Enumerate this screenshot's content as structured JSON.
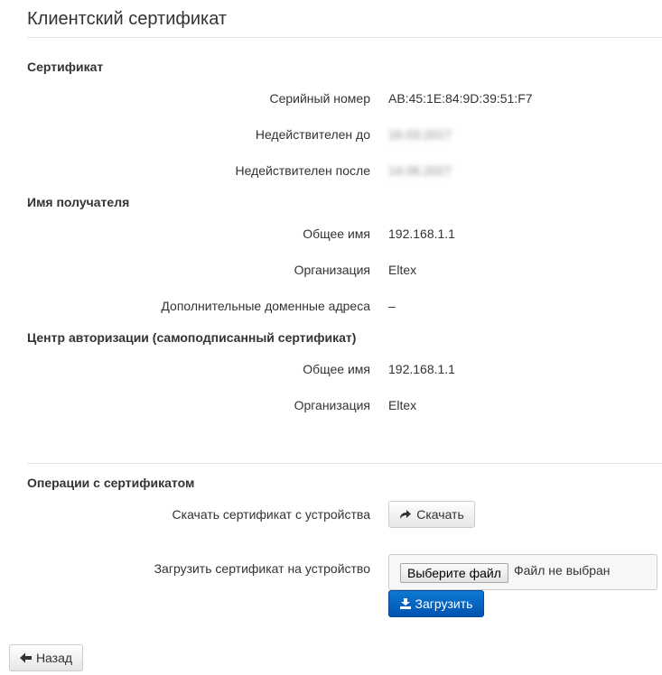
{
  "page": {
    "title": "Клиентский сертификат"
  },
  "certificate": {
    "section_title": "Сертификат",
    "rows": [
      {
        "label": "Серийный номер",
        "value": "AB:45:1E:84:9D:39:51:F7"
      },
      {
        "label": "Недействителен до",
        "value": "16.03.2017"
      },
      {
        "label": "Недействителен после",
        "value": "14.06.2027"
      }
    ]
  },
  "subject": {
    "section_title": "Имя получателя",
    "rows": [
      {
        "label": "Общее имя",
        "value": "192.168.1.1"
      },
      {
        "label": "Организация",
        "value": "Eltex"
      },
      {
        "label": "Дополнительные доменные адреса",
        "value": "–"
      }
    ]
  },
  "issuer": {
    "section_title": "Центр авторизации (самоподписанный сертификат)",
    "rows": [
      {
        "label": "Общее имя",
        "value": "192.168.1.1"
      },
      {
        "label": "Организация",
        "value": "Eltex"
      }
    ]
  },
  "operations": {
    "section_title": "Операции с сертификатом",
    "download_label": "Скачать сертификат с устройства",
    "download_button": "Скачать",
    "download_icon": "share-arrow-icon",
    "upload_label": "Загрузить сертификат на устройство",
    "choose_file_button": "Выберите файл",
    "file_status": "Файл не выбран",
    "upload_button": "Загрузить",
    "upload_icon": "upload-icon",
    "upload_button_color": "#0c6cc4"
  },
  "footer": {
    "back_button": "Назад",
    "back_icon": "arrow-left-icon"
  }
}
